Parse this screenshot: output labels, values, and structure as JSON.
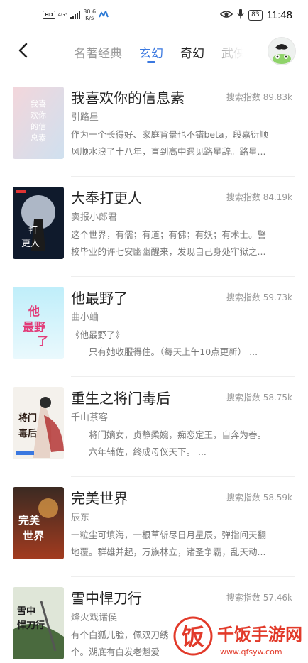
{
  "status_bar": {
    "hd": "HD",
    "network": "4G⁺",
    "speed_value": "30.6",
    "speed_unit": "K/s",
    "battery": "83",
    "time": "11:48"
  },
  "nav": {
    "tabs": [
      {
        "label": "名著经典"
      },
      {
        "label": "玄幻"
      },
      {
        "label": "奇幻"
      },
      {
        "label": "武侠"
      }
    ]
  },
  "books": [
    {
      "title": "我喜欢你的信息素",
      "index": "搜索指数 89.83k",
      "author": "引路星",
      "desc1": "作为一个长得好、家庭背景也不错beta，段嘉衍顺",
      "desc2": "风顺水浪了十八年，直到高中遇见路星辞。路星...",
      "cover_lines": [
        "我喜",
        "欢你",
        "的信",
        "息素"
      ]
    },
    {
      "title": "大奉打更人",
      "index": "搜索指数 84.19k",
      "author": "卖报小郎君",
      "desc1": "这个世界，有儒；有道；有佛；有妖；有术士。警",
      "desc2": "校毕业的许七安幽幽醒来，发现自己身处牢狱之...",
      "cover_lines": [
        "打",
        "更人"
      ]
    },
    {
      "title": "他最野了",
      "index": "搜索指数 59.73k",
      "author": "曲小蛐",
      "desc1": "《他最野了》",
      "desc2": "　　只有她收服得住。（每天上午10点更新） ...",
      "cover_lines": [
        "他",
        "最野",
        "了"
      ]
    },
    {
      "title": "重生之将门毒后",
      "index": "搜索指数 58.75k",
      "author": "千山茶客",
      "desc1": "　　将门嫡女，贞静柔婉，痴恋定王，自奔为眷。",
      "desc2": "　　六年辅佐，终成母仪天下。 ...",
      "cover_lines": [
        "将门",
        "毒后"
      ]
    },
    {
      "title": "完美世界",
      "index": "搜索指数 58.59k",
      "author": "辰东",
      "desc1": "一粒尘可填海，一根草斩尽日月星辰，弹指间天翻",
      "desc2": "地覆。群雄并起，万族林立，诸圣争霸，乱天动...",
      "cover_lines": [
        "完美",
        "世界"
      ]
    },
    {
      "title": "雪中悍刀行",
      "index": "搜索指数 57.46k",
      "author": "烽火戏诸侯",
      "desc1": "有个白狐儿脸，佩双刀绣",
      "desc2": "个。湖底有白发老魁爱",
      "cover_lines": [
        "雪中",
        "悍刀行"
      ]
    }
  ],
  "watermark": {
    "glyph": "饭",
    "name": "千饭手游网",
    "domain": "www.qfsyw.com"
  }
}
